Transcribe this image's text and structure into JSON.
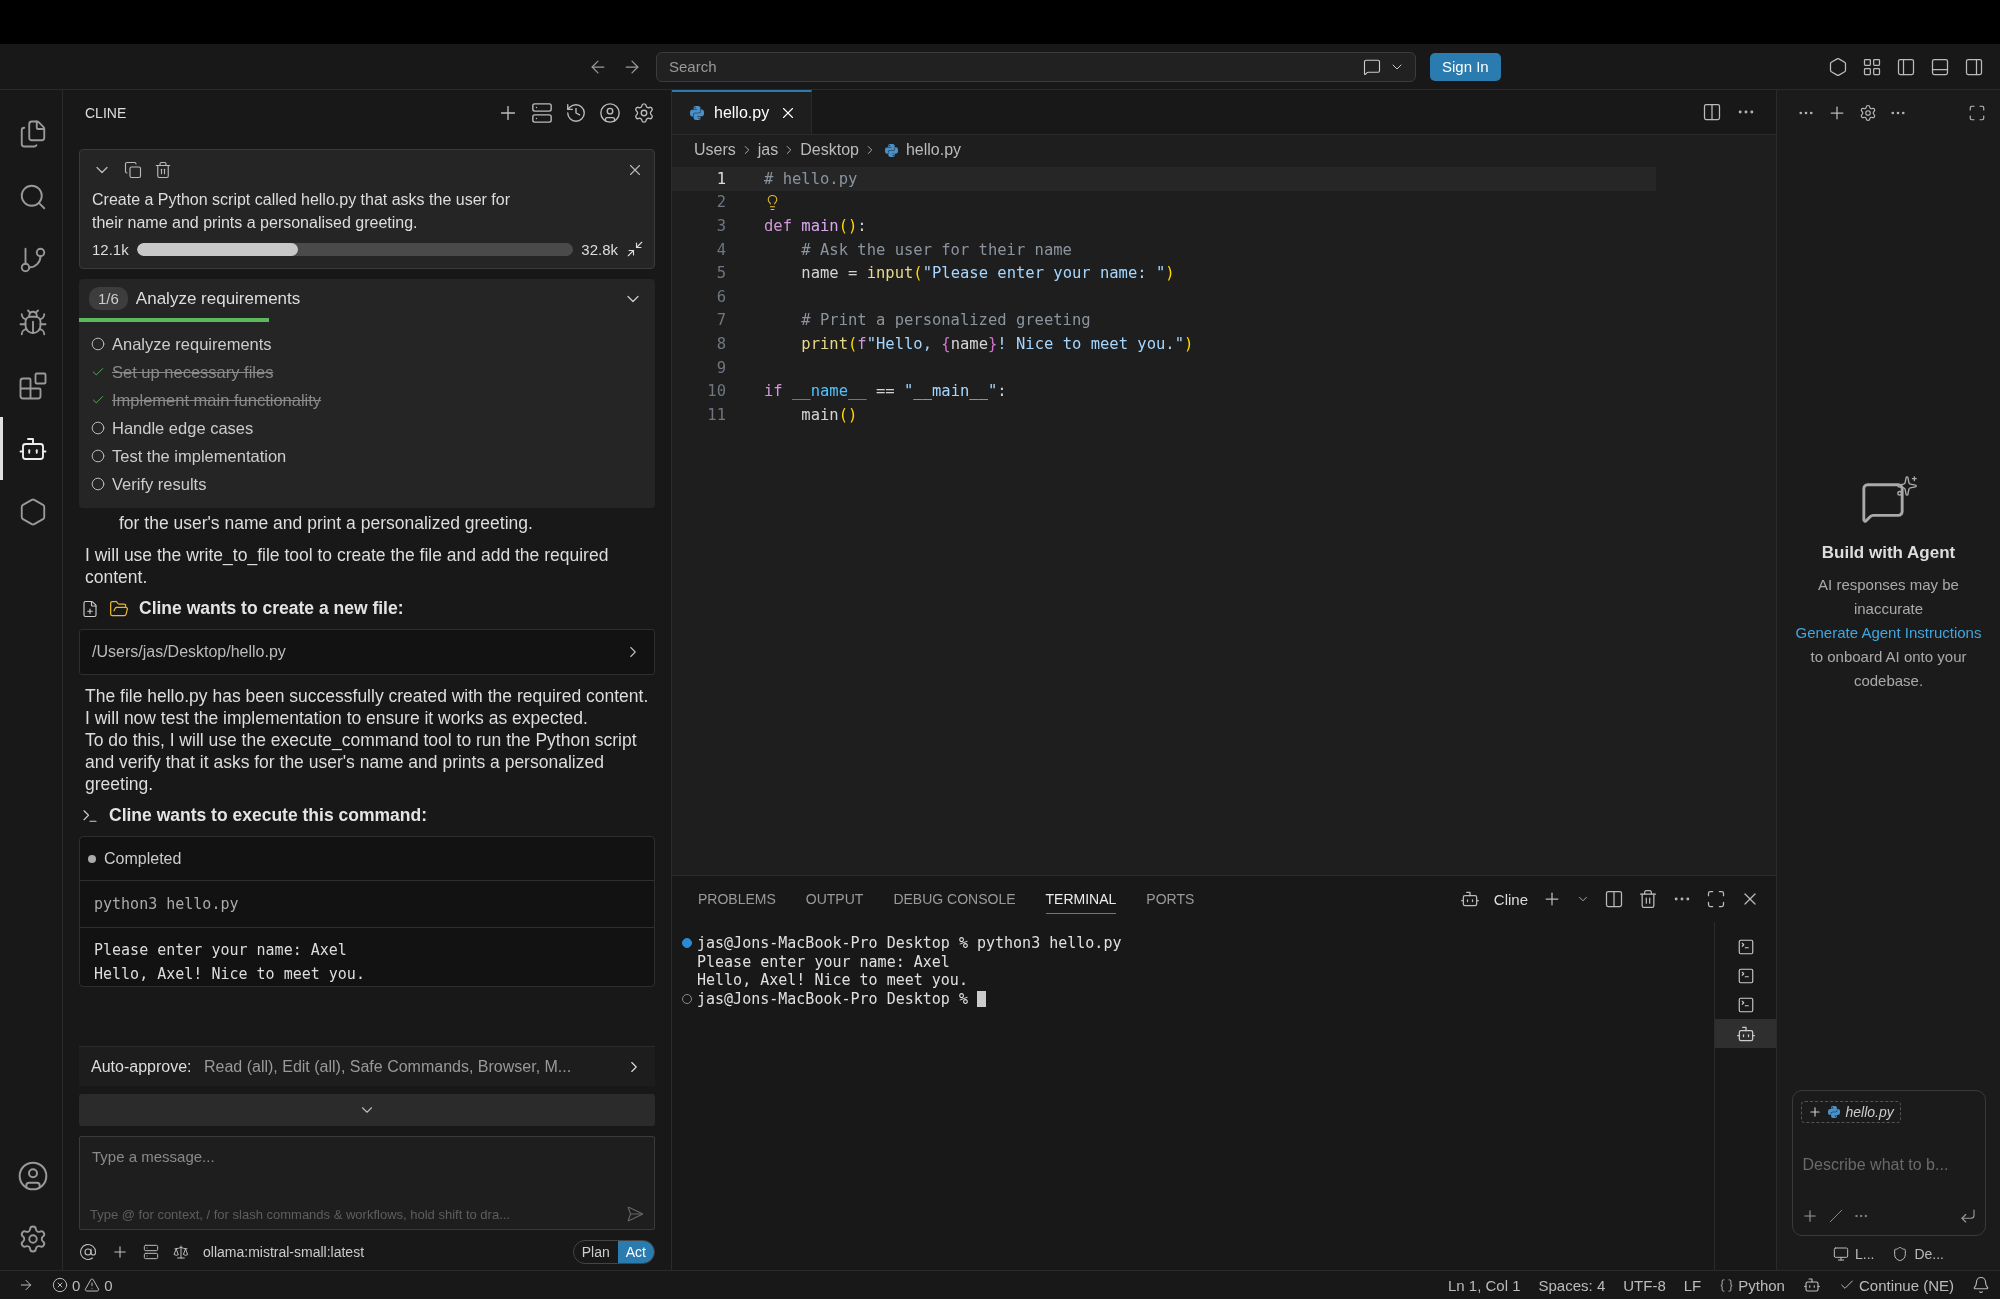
{
  "title_bar": {
    "search_placeholder": "Search",
    "sign_in": "Sign In"
  },
  "activity_bar": {
    "items": [
      {
        "kind": "explorer",
        "selected": false
      },
      {
        "kind": "search",
        "selected": false
      },
      {
        "kind": "source-control",
        "selected": false
      },
      {
        "kind": "run-debug",
        "selected": false
      },
      {
        "kind": "extensions",
        "selected": false
      },
      {
        "kind": "cline",
        "selected": true
      },
      {
        "kind": "remote",
        "selected": false
      }
    ]
  },
  "cline": {
    "header": "CLINE",
    "task": {
      "text": "Create a Python script called hello.py that asks the user for their name and prints a personalised greeting.",
      "tokens_used": "12.1k",
      "level": 0.37,
      "context_window": "32.8k"
    },
    "todo": {
      "counter": "1/6",
      "current": "Analyze requirements",
      "level": 0.33,
      "items": [
        {
          "label": "Analyze requirements",
          "done": false
        },
        {
          "label": "Set up necessary files",
          "done": true
        },
        {
          "label": "Implement main functionality",
          "done": true
        },
        {
          "label": "Handle edge cases",
          "done": false
        },
        {
          "label": "Test the implementation",
          "done": false
        },
        {
          "label": "Verify results",
          "done": false
        }
      ]
    },
    "continuation": "for the user's name and print a personalized greeting.",
    "tool_intro": "I will use the write_to_file tool to create the file and add the required content.",
    "file_request": {
      "title": "Cline wants to create a new file:",
      "path": "/Users/jas/Desktop/hello.py"
    },
    "result_text": [
      "The file hello.py has been successfully created with the required content. I will now test the implementation to ensure it works as expected.",
      "To do this, I will use the execute_command tool to run the Python script and verify that it asks for the user's name and prints a personalized greeting."
    ],
    "command_request": {
      "title": "Cline wants to execute this command:",
      "status": "Completed",
      "command": "python3 hello.py",
      "output": [
        "Please enter your name: Axel",
        "Hello, Axel! Nice to meet you."
      ]
    },
    "auto_approve": {
      "label": "Auto-approve:",
      "value": "Read (all), Edit (all), Safe Commands, Browser, M..."
    },
    "input": {
      "placeholder": "Type a message...",
      "hint": "Type @ for context, / for slash commands & workflows, hold shift to dra..."
    },
    "model": "ollama:mistral-small:latest",
    "modes": [
      {
        "label": "Plan",
        "selected": false
      },
      {
        "label": "Act",
        "selected": true
      }
    ]
  },
  "editor": {
    "tab": "hello.py",
    "breadcrumb": [
      "Users",
      "jas",
      "Desktop",
      "hello.py"
    ],
    "lines": [
      {
        "number": "1",
        "current": true,
        "tokens": [
          {
            "kind": "comment",
            "text": "# hello.py"
          }
        ]
      },
      {
        "number": "2",
        "current": false,
        "lightbulb": true
      },
      {
        "number": "3",
        "current": false,
        "tokens": [
          {
            "kind": "keyword",
            "text": "def "
          },
          {
            "kind": "function",
            "text": "main"
          },
          {
            "kind": "paren",
            "text": "()"
          },
          {
            "kind": "plain",
            "text": ":"
          }
        ]
      },
      {
        "number": "4",
        "current": false,
        "indent": true,
        "tokens": [
          {
            "kind": "comment",
            "text": "# Ask the user for their name"
          }
        ]
      },
      {
        "number": "5",
        "current": false,
        "indent": true,
        "tokens": [
          {
            "kind": "plain",
            "text": "name = "
          },
          {
            "kind": "builtin",
            "text": "input"
          },
          {
            "kind": "paren",
            "text": "("
          },
          {
            "kind": "string",
            "text": "\"Please enter your name: \""
          },
          {
            "kind": "paren",
            "text": ")"
          }
        ]
      },
      {
        "number": "6",
        "current": false
      },
      {
        "number": "7",
        "current": false,
        "indent": true,
        "tokens": [
          {
            "kind": "comment",
            "text": "# Print a personalized greeting"
          }
        ]
      },
      {
        "number": "8",
        "current": false,
        "indent": true,
        "tokens": [
          {
            "kind": "builtin",
            "text": "print"
          },
          {
            "kind": "paren",
            "text": "("
          },
          {
            "kind": "keyword",
            "text": "f"
          },
          {
            "kind": "string",
            "text": "\"Hello, "
          },
          {
            "kind": "brace",
            "text": "{"
          },
          {
            "kind": "plain",
            "text": "name"
          },
          {
            "kind": "brace",
            "text": "}"
          },
          {
            "kind": "string",
            "text": "! Nice to meet you.\""
          },
          {
            "kind": "paren",
            "text": ")"
          }
        ]
      },
      {
        "number": "9",
        "current": false
      },
      {
        "number": "10",
        "current": false,
        "tokens": [
          {
            "kind": "keyword",
            "text": "if "
          },
          {
            "kind": "variable",
            "text": "__name__"
          },
          {
            "kind": "plain",
            "text": " == "
          },
          {
            "kind": "string",
            "text": "\"__main__\""
          },
          {
            "kind": "plain",
            "text": ":"
          }
        ]
      },
      {
        "number": "11",
        "current": false,
        "indent": true,
        "tokens": [
          {
            "kind": "plain",
            "text": "main"
          },
          {
            "kind": "paren",
            "text": "()"
          }
        ]
      }
    ]
  },
  "panel": {
    "tabs": [
      {
        "label": "PROBLEMS",
        "selected": false
      },
      {
        "label": "OUTPUT",
        "selected": false
      },
      {
        "label": "DEBUG CONSOLE",
        "selected": false
      },
      {
        "label": "TERMINAL",
        "selected": true
      },
      {
        "label": "PORTS",
        "selected": false
      }
    ],
    "terminal_name": "Cline",
    "terminal_lines": [
      {
        "kind": "prompt",
        "success": true,
        "text": "jas@Jons-MacBook-Pro Desktop % python3 hello.py"
      },
      {
        "kind": "output",
        "text": "Please enter your name: Axel"
      },
      {
        "kind": "output",
        "text": "Hello, Axel! Nice to meet you."
      },
      {
        "kind": "prompt",
        "success": false,
        "text": "jas@Jons-MacBook-Pro Desktop % "
      }
    ],
    "sessions": [
      {
        "kind": "shell",
        "selected": false
      },
      {
        "kind": "shell",
        "selected": false
      },
      {
        "kind": "shell",
        "selected": false
      },
      {
        "kind": "cline",
        "selected": true
      }
    ]
  },
  "agent_panel": {
    "title": "Build with Agent",
    "note": "AI responses may be inaccurate",
    "link": "Generate Agent Instructions",
    "after_link": " to onboard AI onto your codebase.",
    "context_chip": "hello.py",
    "placeholder": "Describe what to b...",
    "footer": [
      "L...",
      "De..."
    ]
  },
  "status_bar": {
    "errors": "0",
    "warnings": "0",
    "position": "Ln 1, Col 1",
    "spaces": "Spaces: 4",
    "encoding": "UTF-8",
    "eol": "LF",
    "language": "Python",
    "continue": "Continue (NE)"
  }
}
